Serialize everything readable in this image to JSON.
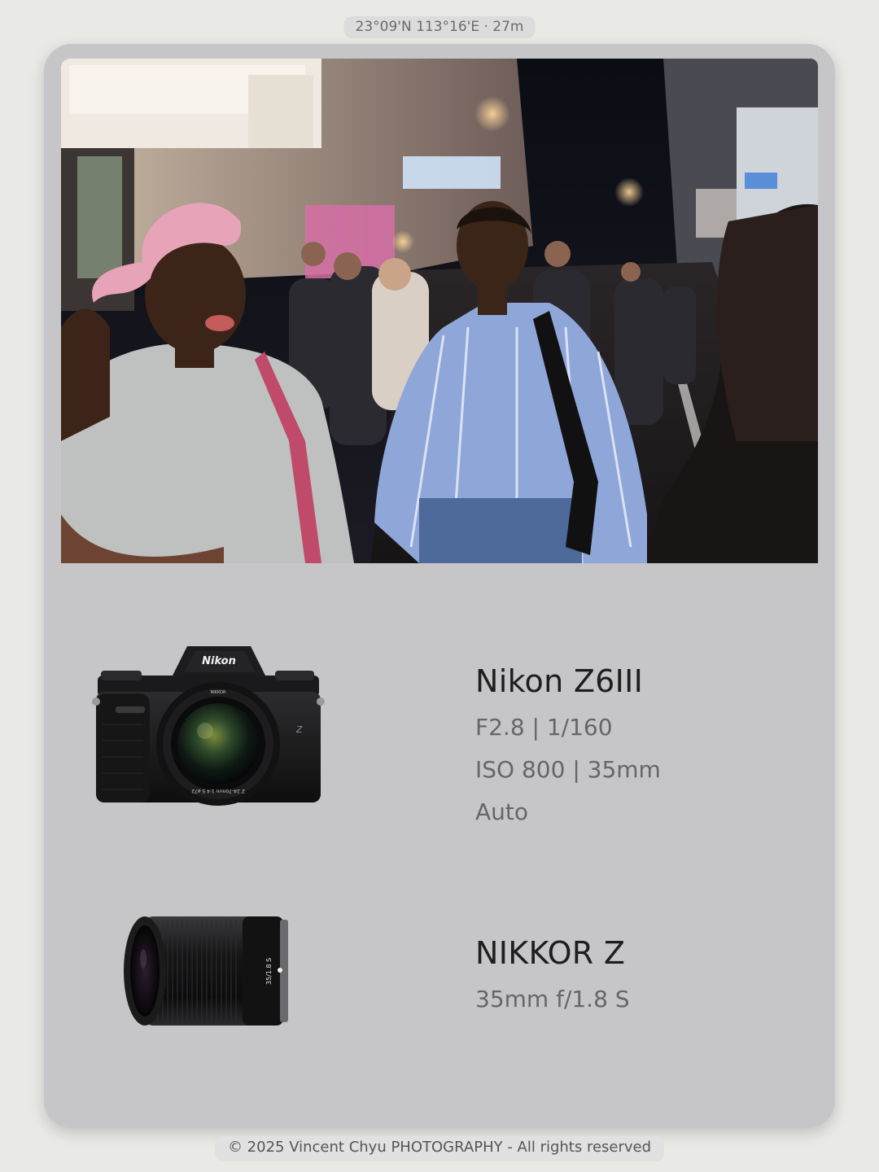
{
  "location": {
    "label": "23°09'N 113°16'E · 27m"
  },
  "camera": {
    "model": "Nikon Z6III",
    "exposure": "F2.8 | 1/160",
    "iso_focal": "ISO 800 | 35mm",
    "mode": "Auto",
    "brand_mark": "Nikon",
    "lens_ring_text": "Z 24-70mm 1:4 S ø72"
  },
  "lens": {
    "name": "NIKKOR Z",
    "spec": "35mm f/1.8 S",
    "barrel_marking": "35/1.8 S"
  },
  "footer": {
    "copyright": "© 2025 Vincent Chyu PHOTOGRAPHY - All rights reserved"
  },
  "colors": {
    "page_bg": "#e9eae6",
    "card_bg": "#c6c6c8",
    "title": "#1e1e1e",
    "spec": "#666666"
  }
}
